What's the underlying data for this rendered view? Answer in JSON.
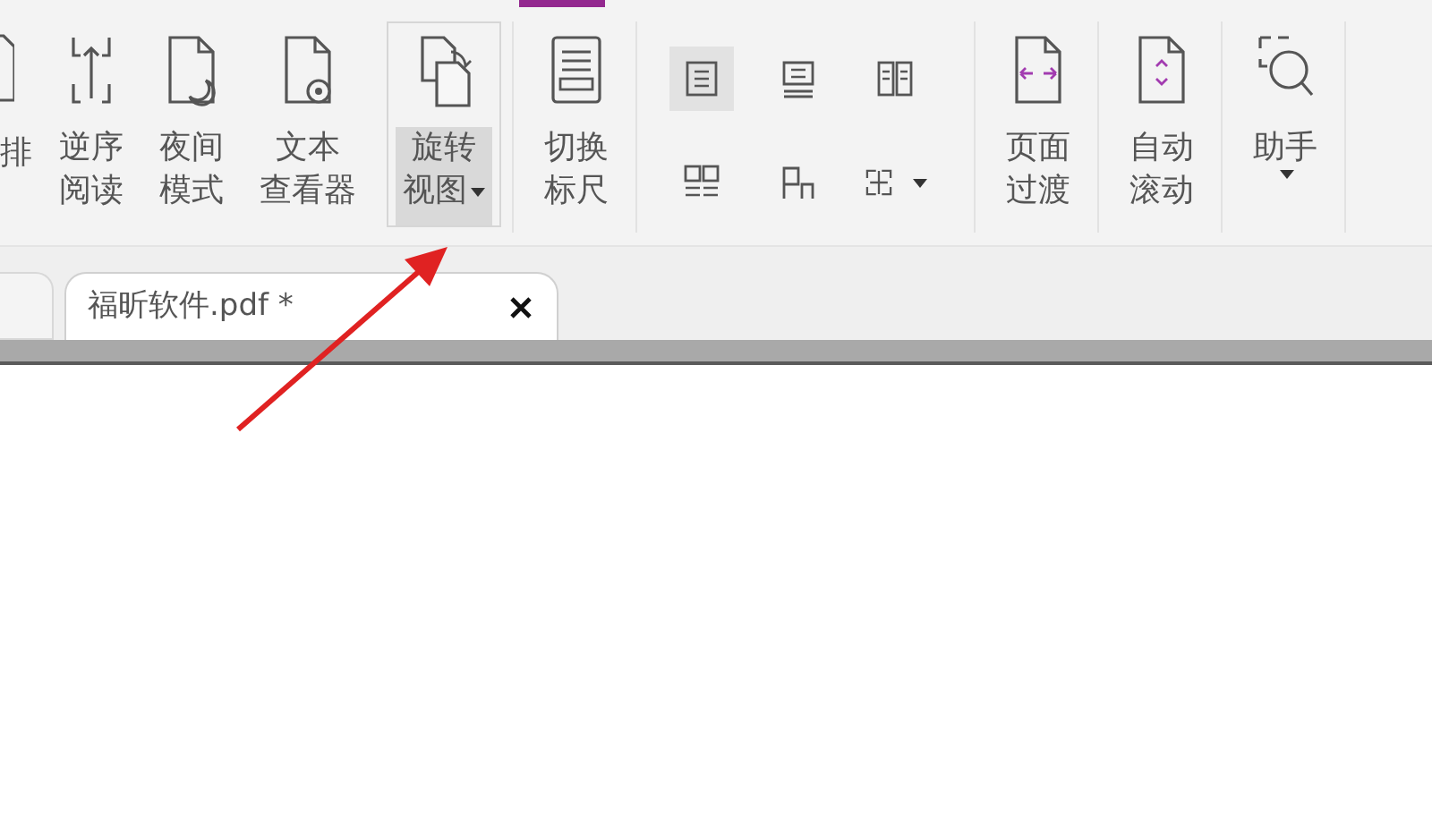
{
  "ribbon": {
    "cut_label": "排",
    "large_left": [
      {
        "lines": [
          "逆序",
          "阅读"
        ],
        "selected": false,
        "dropdown": false
      },
      {
        "lines": [
          "夜间",
          "模式"
        ],
        "selected": false,
        "dropdown": false
      },
      {
        "lines": [
          "文本",
          "查看器"
        ],
        "selected": false,
        "dropdown": false
      },
      {
        "lines": [
          "旋转",
          "视图"
        ],
        "selected": true,
        "dropdown": true
      },
      {
        "lines": [
          "切换",
          "标尺"
        ],
        "selected": false,
        "dropdown": false
      }
    ],
    "small": [
      {
        "selected": true,
        "dropdown": false
      },
      {
        "selected": false,
        "dropdown": false
      },
      {
        "selected": false,
        "dropdown": false
      },
      {
        "selected": false,
        "dropdown": false
      },
      {
        "selected": false,
        "dropdown": false
      },
      {
        "selected": false,
        "dropdown": true
      }
    ],
    "large_right": [
      {
        "lines": [
          "页面",
          "过渡"
        ],
        "selected": false,
        "dropdown": false
      },
      {
        "lines": [
          "自动",
          "滚动"
        ],
        "selected": false,
        "dropdown": false
      },
      {
        "lines": [
          "助手"
        ],
        "selected": false,
        "dropdown": true
      }
    ]
  },
  "tabs": [
    {
      "title": "福昕软件.pdf *",
      "selected": true
    }
  ]
}
